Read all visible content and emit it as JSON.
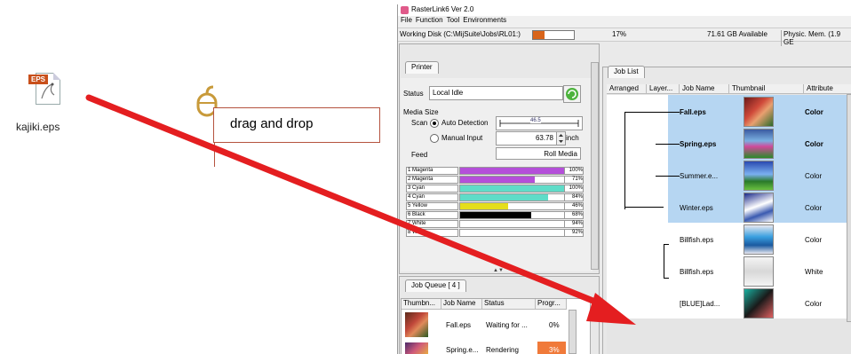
{
  "desktop": {
    "file_badge": "EPS",
    "file_label": "kajiki.eps"
  },
  "callout": {
    "text": "drag and drop"
  },
  "window": {
    "title": "RasterLink6 Ver 2.0",
    "menu": [
      "File",
      "Function",
      "Tool",
      "Environments"
    ],
    "disk": {
      "label": "Working Disk (C:\\MijSuite\\Jobs\\RL01:)",
      "percent_text": "17%",
      "percent_value": 0.17,
      "available": "71.61 GB Available",
      "memory": "Physic. Mem. (1.9 GE"
    }
  },
  "printer": {
    "tab": "Printer",
    "status_label": "Status",
    "status_value": "Local Idle",
    "media_size_label": "Media Size",
    "scan_label": "Scan",
    "auto_detection": "Auto Detection",
    "auto_value": "46.5",
    "manual_input": "Manual Input",
    "manual_value": "63.78",
    "unit": "inch",
    "feed_label": "Feed",
    "feed_value": "Roll Media",
    "inks": [
      {
        "name": "1 Magenta",
        "pct": "100%",
        "level": 1.0,
        "color": "#b44fd9"
      },
      {
        "name": "2 Magenta",
        "pct": "71%",
        "level": 0.71,
        "color": "#b44fd9"
      },
      {
        "name": "3 Cyan",
        "pct": "100%",
        "level": 1.0,
        "color": "#5fdcc8"
      },
      {
        "name": "4 Cyan",
        "pct": "84%",
        "level": 0.84,
        "color": "#5fdcc8"
      },
      {
        "name": "5 Yellow",
        "pct": "46%",
        "level": 0.46,
        "color": "#e5de1b"
      },
      {
        "name": "6 Black",
        "pct": "68%",
        "level": 0.68,
        "color": "#000000"
      },
      {
        "name": "7 White",
        "pct": "94%",
        "level": 0.94,
        "color": "#ffffff"
      },
      {
        "name": "8 White",
        "pct": "92%",
        "level": 0.92,
        "color": "#ffffff"
      }
    ]
  },
  "job_queue": {
    "tab": "Job Queue [ 4 ]",
    "headers": [
      "Thumbn...",
      "Job Name",
      "Status",
      "Progr..."
    ],
    "rows": [
      {
        "name": "Fall.eps",
        "status": "Waiting for ...",
        "progress": "0%"
      },
      {
        "name": "Spring.e...",
        "status": "Rendering",
        "progress": "3%"
      }
    ]
  },
  "job_list": {
    "tab": "Job List",
    "headers": [
      "Arranged",
      "Layer...",
      "Job Name",
      "Thumbnail",
      "Attribute"
    ],
    "rows": [
      {
        "name": "Fall.eps",
        "attr": "Color",
        "selected": true,
        "bold": true
      },
      {
        "name": "Spring.eps",
        "attr": "Color",
        "selected": true,
        "bold": true
      },
      {
        "name": "Summer.e...",
        "attr": "Color",
        "selected": true,
        "bold": false
      },
      {
        "name": "Winter.eps",
        "attr": "Color",
        "selected": true,
        "bold": false
      },
      {
        "name": "Billfish.eps",
        "attr": "Color",
        "selected": false,
        "bold": false
      },
      {
        "name": "Billfish.eps",
        "attr": "White",
        "selected": false,
        "bold": false
      },
      {
        "name": "[BLUE]Lad...",
        "attr": "Color",
        "selected": false,
        "bold": false
      }
    ]
  }
}
